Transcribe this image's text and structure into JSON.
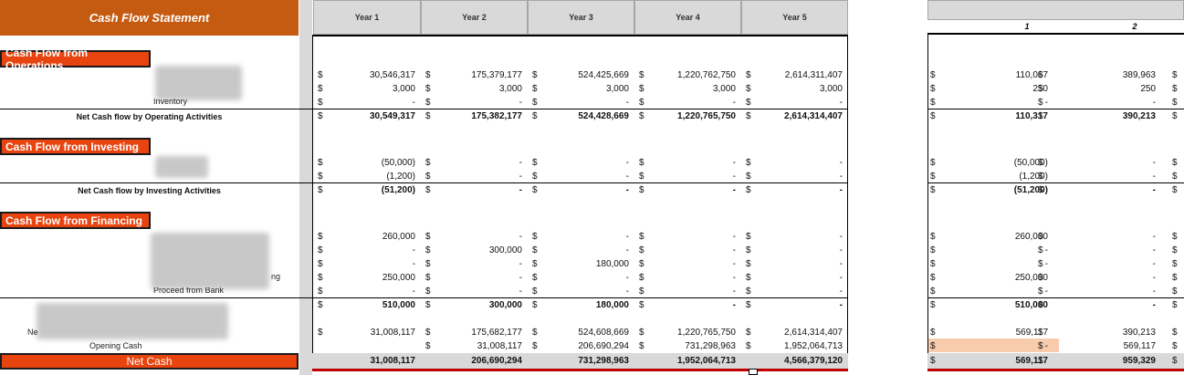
{
  "title": "Cash Flow Statement",
  "years": [
    "Year 1",
    "Year 2",
    "Year 3",
    "Year 4",
    "Year 5"
  ],
  "months": [
    "1",
    "2"
  ],
  "sections": {
    "operations": "Cash Flow from Operations",
    "investing": "Cash Flow from Investing",
    "financing": "Cash Flow from Financing"
  },
  "labels": {
    "inventory": "Inventory",
    "net_operating": "Net Cash flow by Operating Activities",
    "net_investing": "Net Cash flow by Investing Activities",
    "ng_fragment": "ng",
    "proceed_bank": "Proceed from Bank",
    "ne_fragment": "Ne",
    "opening_cash": "Opening Cash",
    "net_cash": "Net Cash"
  },
  "currency": "$",
  "rows": {
    "op1": {
      "years": [
        "30,546,317",
        "175,379,177",
        "524,425,669",
        "1,220,762,750",
        "2,614,311,407"
      ],
      "months": [
        "110,067",
        "389,963"
      ]
    },
    "op2": {
      "years": [
        "3,000",
        "3,000",
        "3,000",
        "3,000",
        "3,000"
      ],
      "months": [
        "250",
        "250"
      ]
    },
    "op3": {
      "years": [
        "-",
        "-",
        "-",
        "-",
        "-"
      ],
      "months": [
        "-",
        "-"
      ]
    },
    "opnet": {
      "years": [
        "30,549,317",
        "175,382,177",
        "524,428,669",
        "1,220,765,750",
        "2,614,314,407"
      ],
      "months": [
        "110,317",
        "390,213"
      ]
    },
    "inv1": {
      "years": [
        "(50,000)",
        "-",
        "-",
        "-",
        "-"
      ],
      "months": [
        "(50,000)",
        "-"
      ]
    },
    "inv2": {
      "years": [
        "(1,200)",
        "-",
        "-",
        "-",
        "-"
      ],
      "months": [
        "(1,200)",
        "-"
      ]
    },
    "invnet": {
      "years": [
        "(51,200)",
        "-",
        "-",
        "-",
        "-"
      ],
      "months": [
        "(51,200)",
        "-"
      ]
    },
    "fin1": {
      "years": [
        "260,000",
        "-",
        "-",
        "-",
        "-"
      ],
      "months": [
        "260,000",
        "-"
      ]
    },
    "fin2": {
      "years": [
        "-",
        "300,000",
        "-",
        "-",
        "-"
      ],
      "months": [
        "-",
        "-"
      ]
    },
    "fin3": {
      "years": [
        "-",
        "-",
        "180,000",
        "-",
        "-"
      ],
      "months": [
        "-",
        "-"
      ]
    },
    "fin4": {
      "years": [
        "250,000",
        "-",
        "-",
        "-",
        "-"
      ],
      "months": [
        "250,000",
        "-"
      ]
    },
    "fin5": {
      "years": [
        "-",
        "-",
        "-",
        "-",
        "-"
      ],
      "months": [
        "-",
        "-"
      ]
    },
    "finnet": {
      "years": [
        "510,000",
        "300,000",
        "180,000",
        "-",
        "-"
      ],
      "months": [
        "510,000",
        "-"
      ]
    },
    "net1": {
      "years": [
        "31,008,117",
        "175,682,177",
        "524,608,669",
        "1,220,765,750",
        "2,614,314,407"
      ],
      "months": [
        "569,117",
        "390,213"
      ]
    },
    "open": {
      "years": [
        "",
        "31,008,117",
        "206,690,294",
        "731,298,963",
        "1,952,064,713"
      ],
      "months": [
        "-",
        "569,117"
      ]
    },
    "netcash": {
      "years": [
        "31,008,117",
        "206,690,294",
        "731,298,963",
        "1,952,064,713",
        "4,566,379,120"
      ],
      "months": [
        "569,117",
        "959,329"
      ]
    }
  }
}
